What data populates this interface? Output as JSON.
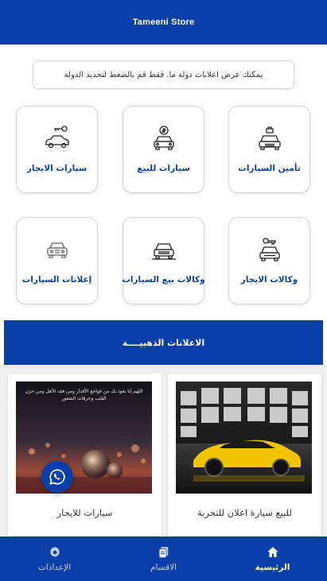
{
  "header": {
    "title": "Tameeni Store"
  },
  "notice": {
    "text": "يمكنك عرض اعلانات دولة ما. فقط قم بالضغط لتحديد الدولة"
  },
  "categories": [
    {
      "label": "تأمين السيارات",
      "icon": "car-insurance-icon"
    },
    {
      "label": "سيارات للبيع",
      "icon": "car-sale-icon"
    },
    {
      "label": "سيارات الايجار",
      "icon": "car-rent-key-icon"
    },
    {
      "label": "وكالات الايجار",
      "icon": "rental-agency-icon"
    },
    {
      "label": "وكالات بيع السيارات",
      "icon": "car-dealer-icon"
    },
    {
      "label": "إعلانات السيارات",
      "icon": "car-ads-icon"
    }
  ],
  "gold_banner": {
    "title": "الاعلانات الذهبيــــة"
  },
  "ads": [
    {
      "title": "للبيع سيارة اعلان للتجربة",
      "image": "yellow-sports-car-image"
    },
    {
      "title": "سيارات للايجار",
      "image": "glass-ball-bokeh-image",
      "overlay_text": "اللهم إنا نعوذ بك من فواجع الأقدار ومن فقد الأهل ومن حزن القلب وحرقات الشعور"
    }
  ],
  "whatsapp": {
    "icon": "whatsapp-icon"
  },
  "bottom_nav": [
    {
      "label": "الرئيسية",
      "icon": "home-icon",
      "active": true
    },
    {
      "label": "الاقسام",
      "icon": "sections-icon",
      "active": false
    },
    {
      "label": "الإعدادات",
      "icon": "settings-gear-icon",
      "active": false
    }
  ],
  "colors": {
    "primary": "#0a3ea8",
    "background": "#ffffff",
    "ad_area": "#f0f0f0"
  }
}
